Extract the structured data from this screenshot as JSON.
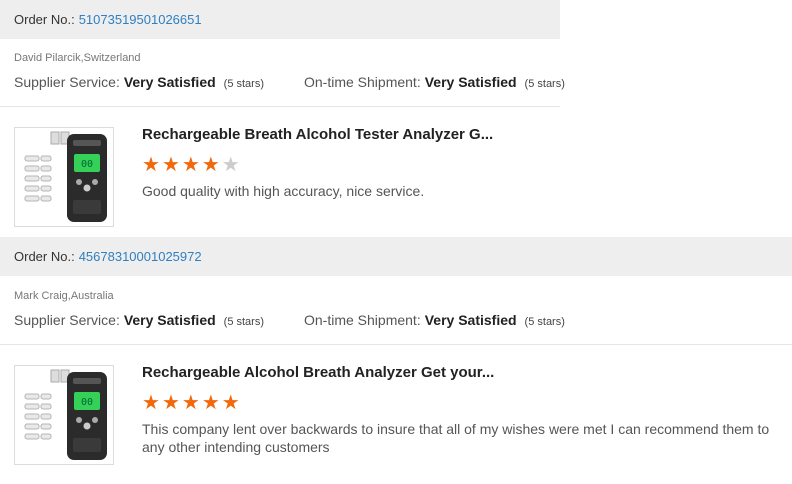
{
  "reviews": [
    {
      "order_label": "Order No.:",
      "order_number": "51073519501026651",
      "reviewer": "David Pilarcik,Switzerland",
      "supplier_label": "Supplier Service:",
      "supplier_value": "Very Satisfied",
      "supplier_stars": "(5 stars)",
      "shipment_label": "On-time Shipment:",
      "shipment_value": "Very Satisfied",
      "shipment_stars": "(5 stars)",
      "product_title": "Rechargeable Breath Alcohol Tester Analyzer G...",
      "rating": 4,
      "comment": "Good quality with high accuracy, nice service."
    },
    {
      "order_label": "Order No.:",
      "order_number": "45678310001025972",
      "reviewer": "Mark Craig,Australia",
      "supplier_label": "Supplier Service:",
      "supplier_value": "Very Satisfied",
      "supplier_stars": "(5 stars)",
      "shipment_label": "On-time Shipment:",
      "shipment_value": "Very Satisfied",
      "shipment_stars": "(5 stars)",
      "product_title": "Rechargeable Alcohol Breath Analyzer Get your...",
      "rating": 5,
      "comment": "This company lent over backwards to insure that all of my wishes were met I can recommend them to any other intending customers"
    }
  ],
  "rating_max": 5,
  "colors": {
    "star_active": "#f2680c",
    "star_inactive": "#cccccc",
    "link": "#2f7fc1",
    "header_bg": "#eeeeee"
  },
  "icons": {
    "star": "star-icon",
    "product_image": "breathalyzer-product-image"
  }
}
